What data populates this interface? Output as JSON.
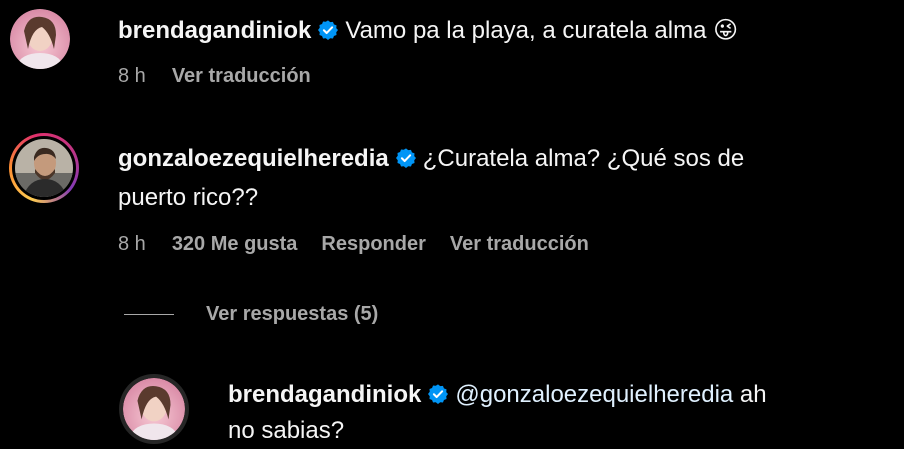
{
  "comments": [
    {
      "username": "brendagandiniok",
      "verified": true,
      "text": "Vamo pa la playa, a curatela alma 😜",
      "time": "8 h",
      "actions": [
        "Ver traducción"
      ]
    },
    {
      "username": "gonzaloezequielheredia",
      "verified": true,
      "text_line1": "¿Curatela alma? ¿Qué sos de",
      "text_line2": "puerto rico??",
      "time": "8 h",
      "likes": "320 Me gusta",
      "reply": "Responder",
      "translate": "Ver traducción",
      "story_ring": true
    }
  ],
  "replies_toggle": {
    "label": "Ver respuestas (5)"
  },
  "reply": {
    "username": "brendagandiniok",
    "verified": true,
    "mention": "@gonzaloezequielheredia",
    "text_line1_rest": " ah",
    "text_line2": "no sabias?"
  },
  "colors": {
    "background": "#000000",
    "primary_text": "#f5f5f5",
    "secondary_text": "#a8a8a8",
    "verified_badge": "#0095f6",
    "mention": "#e0f1ff"
  },
  "icons": {
    "verified": "verified-badge-icon",
    "emoji": "winking-face-with-tongue"
  }
}
